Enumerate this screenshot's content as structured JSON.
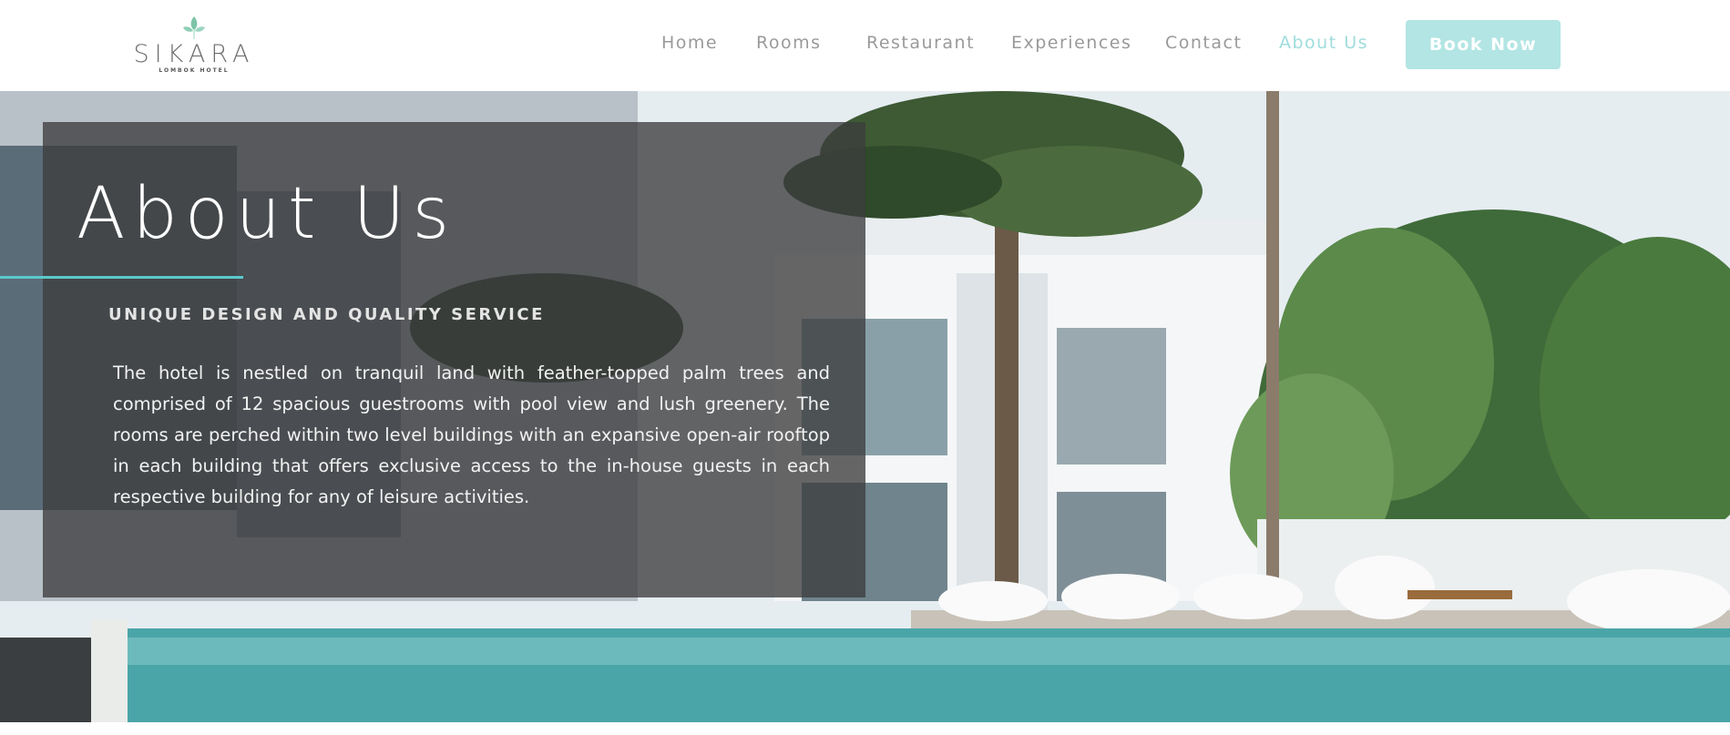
{
  "brand": {
    "name": "SIKARA",
    "tagline": "LOMBOK HOTEL",
    "accent_color": "#5ac9cc",
    "button_color": "#b2e5e3"
  },
  "nav": {
    "items": [
      {
        "label": "Home"
      },
      {
        "label": "Rooms"
      },
      {
        "label": "Restaurant"
      },
      {
        "label": "Experiences"
      },
      {
        "label": "Contact"
      },
      {
        "label": "About Us",
        "active": true
      }
    ],
    "cta_label": "Book Now"
  },
  "hero": {
    "title": "About Us",
    "subtitle": "UNIQUE DESIGN AND QUALITY SERVICE",
    "body": "The hotel is nestled on tranquil land with feather-topped palm trees and comprised of 12 spacious guestrooms with pool view and lush greenery. The rooms are perched within two level buildings with an expansive open-air rooftop in each building that offers exclusive access to the in-house guests in each respective building for any of leisure activities."
  }
}
